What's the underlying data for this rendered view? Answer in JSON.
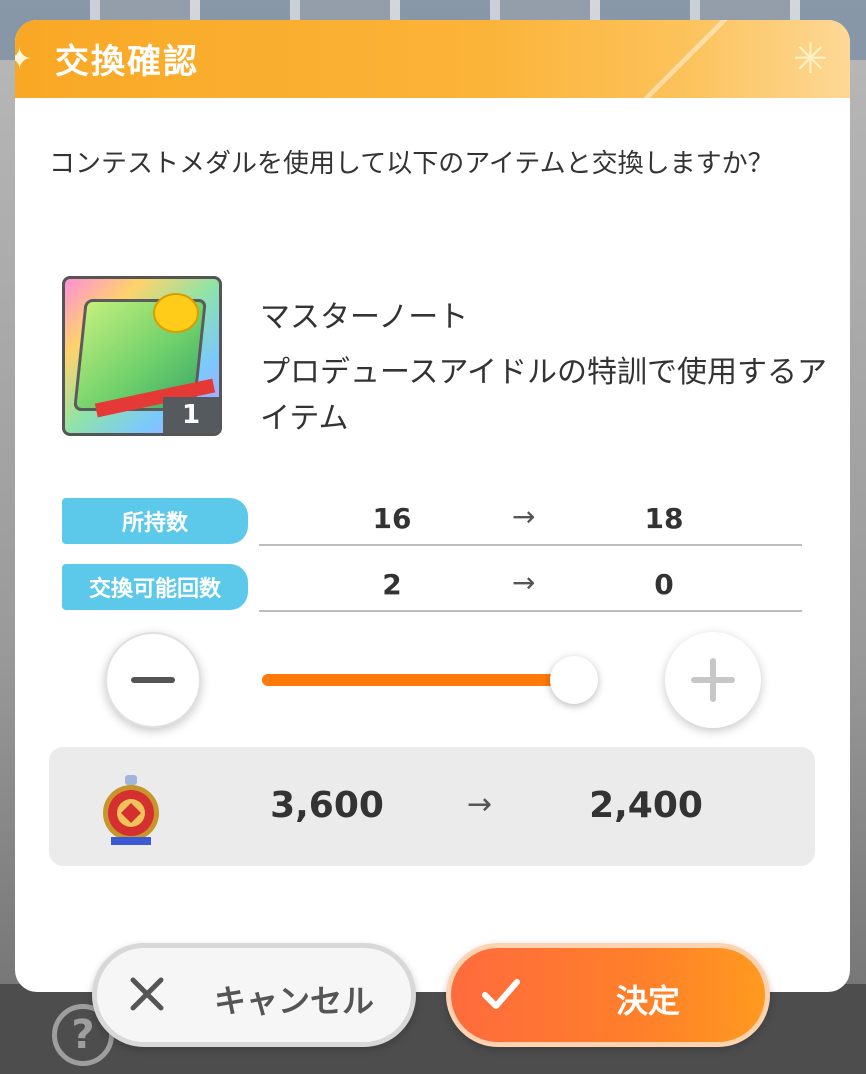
{
  "dialog": {
    "title": "交換確認",
    "message": "コンテストメダルを使用して以下のアイテムと交換しますか？"
  },
  "item": {
    "name": "マスターノート",
    "description": "プロデュースアイドルの特訓で使用するアイテム",
    "quantity": "1",
    "icon": "master-note-icon"
  },
  "stats": {
    "owned": {
      "label": "所持数",
      "from": "16",
      "to": "18"
    },
    "exchangeable": {
      "label": "交換可能回数",
      "from": "2",
      "to": "0"
    },
    "arrow": "→"
  },
  "slider": {
    "value_fraction": 1.0
  },
  "cost": {
    "from": "3,600",
    "to": "2,400",
    "arrow": "→",
    "icon": "contest-medal-icon"
  },
  "buttons": {
    "cancel_label": "キャンセル",
    "confirm_label": "決定"
  },
  "colors": {
    "header_accent": "#f9a825",
    "stat_label": "#5cc8ea",
    "slider_fill": "#ff7a0a",
    "confirm_button": "#ff7f2a"
  }
}
